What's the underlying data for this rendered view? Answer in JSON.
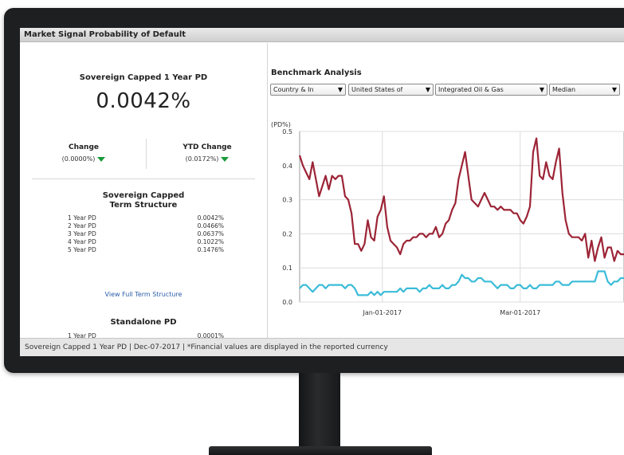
{
  "panel": {
    "title": "Market Signal Probability of Default"
  },
  "summary": {
    "title": "Sovereign Capped 1 Year PD",
    "value": "0.0042%",
    "change_label": "Change",
    "change_value": "(0.0000%)",
    "ytd_label": "YTD Change",
    "ytd_value": "(0.0172%)",
    "change_direction": "down",
    "down_color": "#1a9a3a"
  },
  "term_structure": {
    "title_line1": "Sovereign Capped",
    "title_line2": "Term Structure",
    "rows": [
      {
        "label": "1 Year PD",
        "value": "0.0042%"
      },
      {
        "label": "2 Year PD",
        "value": "0.0466%"
      },
      {
        "label": "3 Year PD",
        "value": "0.0637%"
      },
      {
        "label": "4 Year PD",
        "value": "0.1022%"
      },
      {
        "label": "5 Year PD",
        "value": "0.1476%"
      }
    ],
    "link": "View Full Term Structure"
  },
  "standalone": {
    "title": "Standalone PD",
    "rows": [
      {
        "label": "1 Year PD",
        "value": "0.0001%"
      }
    ]
  },
  "benchmark": {
    "title": "Benchmark Analysis",
    "filters": [
      "Country & In",
      "United States of",
      "Integrated Oil & Gas",
      "Median"
    ]
  },
  "footer": {
    "text": "Sovereign Capped 1 Year PD | Dec-07-2017 | *Financial values are displayed in the reported currency"
  },
  "chart_data": {
    "type": "line",
    "ylabel": "(PD%)",
    "ylim": [
      0,
      0.5
    ],
    "yticks": [
      "0.0",
      "0.1",
      "0.2",
      "0.3",
      "0.4",
      "0.5"
    ],
    "xticks": [
      "Jan-01-2017",
      "Mar-01-2017"
    ],
    "grid": true,
    "series": [
      {
        "color": "#9c2436",
        "values": [
          0.43,
          0.4,
          0.38,
          0.36,
          0.41,
          0.36,
          0.31,
          0.34,
          0.37,
          0.33,
          0.37,
          0.36,
          0.37,
          0.37,
          0.31,
          0.3,
          0.26,
          0.17,
          0.17,
          0.15,
          0.17,
          0.24,
          0.19,
          0.18,
          0.25,
          0.27,
          0.31,
          0.22,
          0.18,
          0.17,
          0.16,
          0.14,
          0.17,
          0.18,
          0.18,
          0.19,
          0.19,
          0.2,
          0.2,
          0.19,
          0.2,
          0.2,
          0.22,
          0.19,
          0.2,
          0.23,
          0.24,
          0.27,
          0.29,
          0.36,
          0.4,
          0.44,
          0.37,
          0.3,
          0.29,
          0.28,
          0.3,
          0.32,
          0.3,
          0.28,
          0.28,
          0.27,
          0.28,
          0.27,
          0.27,
          0.27,
          0.26,
          0.26,
          0.24,
          0.23,
          0.25,
          0.28,
          0.44,
          0.48,
          0.37,
          0.36,
          0.41,
          0.37,
          0.36,
          0.41,
          0.45,
          0.32,
          0.24,
          0.2,
          0.19,
          0.19,
          0.19,
          0.18,
          0.2,
          0.13,
          0.18,
          0.12,
          0.16,
          0.19,
          0.13,
          0.16,
          0.16,
          0.12,
          0.15,
          0.14,
          0.14
        ]
      },
      {
        "color": "#3bbcd8",
        "values": [
          0.04,
          0.05,
          0.05,
          0.04,
          0.03,
          0.04,
          0.05,
          0.05,
          0.04,
          0.05,
          0.05,
          0.05,
          0.05,
          0.05,
          0.04,
          0.05,
          0.05,
          0.04,
          0.02,
          0.02,
          0.02,
          0.02,
          0.03,
          0.02,
          0.03,
          0.02,
          0.03,
          0.03,
          0.03,
          0.03,
          0.03,
          0.04,
          0.03,
          0.04,
          0.04,
          0.04,
          0.04,
          0.03,
          0.04,
          0.04,
          0.05,
          0.04,
          0.04,
          0.04,
          0.05,
          0.04,
          0.04,
          0.05,
          0.05,
          0.06,
          0.08,
          0.07,
          0.07,
          0.06,
          0.06,
          0.07,
          0.07,
          0.06,
          0.06,
          0.06,
          0.05,
          0.04,
          0.05,
          0.05,
          0.05,
          0.04,
          0.04,
          0.05,
          0.05,
          0.04,
          0.04,
          0.05,
          0.04,
          0.04,
          0.05,
          0.05,
          0.05,
          0.05,
          0.05,
          0.06,
          0.06,
          0.05,
          0.05,
          0.05,
          0.06,
          0.06,
          0.06,
          0.06,
          0.06,
          0.06,
          0.06,
          0.06,
          0.09,
          0.09,
          0.09,
          0.06,
          0.05,
          0.06,
          0.06,
          0.07,
          0.07
        ]
      }
    ]
  }
}
